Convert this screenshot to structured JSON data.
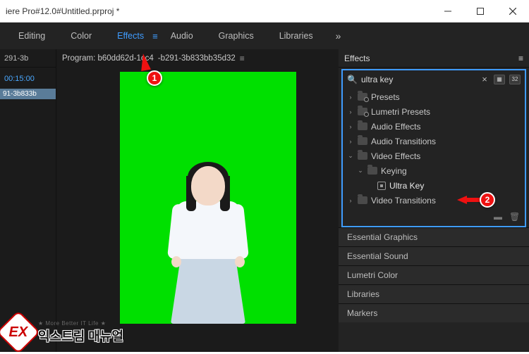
{
  "titlebar": {
    "title": "iere Pro#12.0#Untitled.prproj *"
  },
  "workspaces": {
    "items": [
      "Editing",
      "Color",
      "Effects",
      "Audio",
      "Graphics",
      "Libraries"
    ],
    "active_index": 2
  },
  "source_panel": {
    "tab_label": "291-3b",
    "timecode": "00:15:00",
    "clip_name": "91-3b833b"
  },
  "program": {
    "label": "Program: b60dd62d-1cc4",
    "label_suffix": "-b291-3b833bb35d32"
  },
  "effects": {
    "panel_title": "Effects",
    "search_value": "ultra key",
    "tree": {
      "presets": "Presets",
      "lumetri": "Lumetri Presets",
      "audio_effects": "Audio Effects",
      "audio_transitions": "Audio Transitions",
      "video_effects": "Video Effects",
      "keying": "Keying",
      "ultra_key": "Ultra Key",
      "video_transitions": "Video Transitions"
    }
  },
  "side_panels": [
    "Essential Graphics",
    "Essential Sound",
    "Lumetri Color",
    "Libraries",
    "Markers"
  ],
  "callouts": {
    "one": "1",
    "two": "2"
  },
  "watermark": {
    "sub": "★ More Better IT Life ★",
    "main": "익스트림 매뉴얼",
    "logo": "EX"
  }
}
